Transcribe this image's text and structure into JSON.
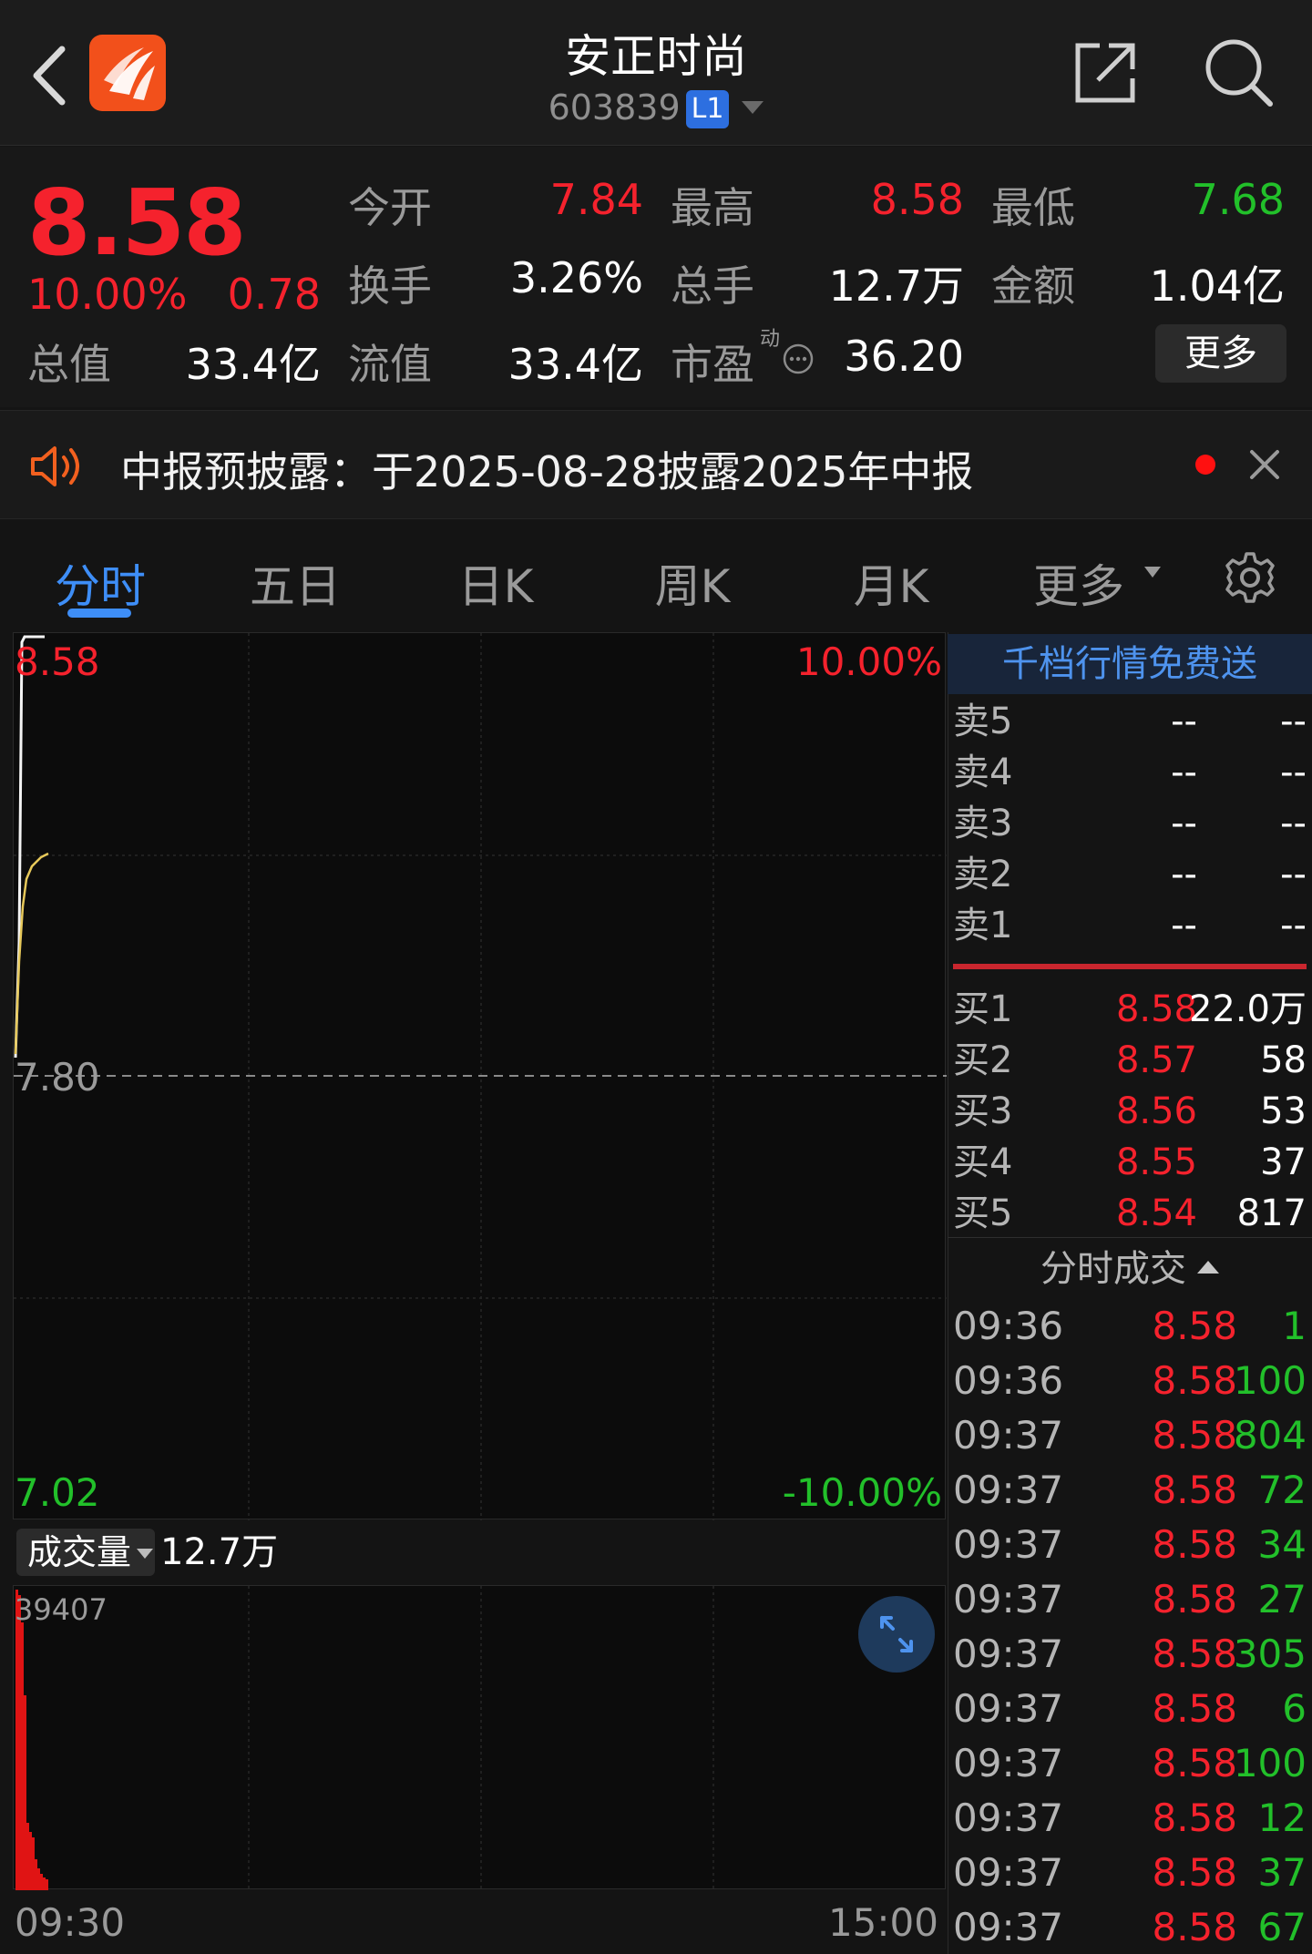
{
  "header": {
    "title": "安正时尚",
    "code": "603839",
    "level_badge": "L1"
  },
  "quote": {
    "price": "8.58",
    "change_pct": "10.00%",
    "change": "0.78",
    "total_value_label": "总值",
    "total_value": "33.4亿",
    "rows": [
      [
        {
          "label": "今开",
          "value": "7.84",
          "color": "red"
        },
        {
          "label": "最高",
          "value": "8.58",
          "color": "red"
        },
        {
          "label": "最低",
          "value": "7.68",
          "color": "green"
        }
      ],
      [
        {
          "label": "换手",
          "value": "3.26%",
          "color": "white"
        },
        {
          "label": "总手",
          "value": "12.7万",
          "color": "white"
        },
        {
          "label": "金额",
          "value": "1.04亿",
          "color": "white"
        }
      ],
      [
        {
          "label": "流值",
          "value": "33.4亿",
          "color": "white"
        },
        {
          "label": "市盈",
          "value": "36.20",
          "color": "white"
        }
      ]
    ],
    "pe_superscript": "动",
    "more_button": "更多"
  },
  "notice": {
    "text": "中报预披露：于2025-08-28披露2025年中报"
  },
  "tabs": [
    "分时",
    "五日",
    "日K",
    "周K",
    "月K",
    "更多"
  ],
  "chart": {
    "top_price": "8.58",
    "top_pct": "10.00%",
    "mid_price": "7.80",
    "bottom_price": "7.02",
    "bottom_pct": "-10.00%",
    "volume_selector": "成交量",
    "volume_total": "12.7万",
    "volume_max": "39407",
    "time_start": "09:30",
    "time_end": "15:00"
  },
  "order_book": {
    "promo": "千档行情免费送",
    "sells": [
      {
        "label": "卖5",
        "price": "--",
        "volume": "--"
      },
      {
        "label": "卖4",
        "price": "--",
        "volume": "--"
      },
      {
        "label": "卖3",
        "price": "--",
        "volume": "--"
      },
      {
        "label": "卖2",
        "price": "--",
        "volume": "--"
      },
      {
        "label": "卖1",
        "price": "--",
        "volume": "--"
      }
    ],
    "buys": [
      {
        "label": "买1",
        "price": "8.58",
        "volume": "22.0万"
      },
      {
        "label": "买2",
        "price": "8.57",
        "volume": "58"
      },
      {
        "label": "买3",
        "price": "8.56",
        "volume": "53"
      },
      {
        "label": "买4",
        "price": "8.55",
        "volume": "37"
      },
      {
        "label": "买5",
        "price": "8.54",
        "volume": "817"
      }
    ]
  },
  "ticks": {
    "header": "分时成交",
    "rows": [
      {
        "time": "09:36",
        "price": "8.58",
        "volume": "1"
      },
      {
        "time": "09:36",
        "price": "8.58",
        "volume": "100"
      },
      {
        "time": "09:37",
        "price": "8.58",
        "volume": "804"
      },
      {
        "time": "09:37",
        "price": "8.58",
        "volume": "72"
      },
      {
        "time": "09:37",
        "price": "8.58",
        "volume": "34"
      },
      {
        "time": "09:37",
        "price": "8.58",
        "volume": "27"
      },
      {
        "time": "09:37",
        "price": "8.58",
        "volume": "305"
      },
      {
        "time": "09:37",
        "price": "8.58",
        "volume": "6"
      },
      {
        "time": "09:37",
        "price": "8.58",
        "volume": "100"
      },
      {
        "time": "09:37",
        "price": "8.58",
        "volume": "12"
      },
      {
        "time": "09:37",
        "price": "8.58",
        "volume": "37"
      },
      {
        "time": "09:37",
        "price": "8.58",
        "volume": "67"
      }
    ]
  },
  "colors": {
    "up": "#f5222d",
    "down": "#22c02a",
    "accent": "#3e8ef7",
    "background": "#141414"
  }
}
